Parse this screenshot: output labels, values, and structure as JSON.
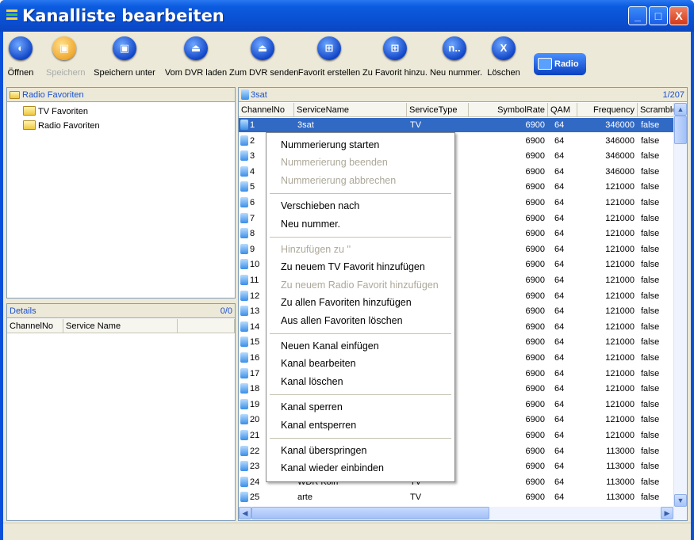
{
  "window": {
    "title": "Kanalliste bearbeiten",
    "controls": [
      "_",
      "□",
      "X"
    ]
  },
  "toolbar": {
    "buttons": [
      {
        "label": "Öffnen",
        "icon": "open-icon",
        "glyph": "◐",
        "enabled": true
      },
      {
        "label": "Speichern",
        "icon": "save-icon",
        "glyph": "▣",
        "enabled": false
      },
      {
        "label": "Speichern unter",
        "icon": "save-as-icon",
        "glyph": "▣",
        "enabled": true
      },
      {
        "label": "Vom DVR laden",
        "icon": "download-icon",
        "glyph": "⏏",
        "enabled": true
      },
      {
        "label": "Zum DVR senden",
        "icon": "upload-icon",
        "glyph": "⏏",
        "enabled": true
      },
      {
        "label": "Favorit erstellen",
        "icon": "create-favorite-icon",
        "glyph": "⊞",
        "enabled": true
      },
      {
        "label": "Zu Favorit hinzu.",
        "icon": "add-favorite-icon",
        "glyph": "⊞",
        "enabled": true
      },
      {
        "label": "Neu nummer.",
        "icon": "renumber-icon",
        "glyph": "n..",
        "enabled": true
      },
      {
        "label": "Löschen",
        "icon": "delete-icon",
        "glyph": "X",
        "enabled": true
      }
    ],
    "radio_label": "Radio"
  },
  "left_panel": {
    "header": "Radio Favoriten",
    "tree": [
      "TV Favoriten",
      "Radio Favoriten"
    ]
  },
  "details_panel": {
    "header": "Details",
    "count": "0/0",
    "columns": [
      "ChannelNo",
      "Service Name"
    ]
  },
  "channel_panel": {
    "header": "3sat",
    "count": "1/207",
    "columns": [
      "ChannelNo",
      "ServiceName",
      "ServiceType",
      "SymbolRate",
      "QAM",
      "Frequency",
      "Scramble"
    ],
    "rows": [
      {
        "no": "1",
        "name": "3sat",
        "type": "TV",
        "symbol": "6900",
        "qam": "64",
        "freq": "346000",
        "scr": "false"
      },
      {
        "no": "2",
        "name": "",
        "type": "",
        "symbol": "6900",
        "qam": "64",
        "freq": "346000",
        "scr": "false"
      },
      {
        "no": "3",
        "name": "",
        "type": "",
        "symbol": "6900",
        "qam": "64",
        "freq": "346000",
        "scr": "false"
      },
      {
        "no": "4",
        "name": "",
        "type": "",
        "symbol": "6900",
        "qam": "64",
        "freq": "346000",
        "scr": "false"
      },
      {
        "no": "5",
        "name": "",
        "type": "",
        "symbol": "6900",
        "qam": "64",
        "freq": "121000",
        "scr": "false"
      },
      {
        "no": "6",
        "name": "",
        "type": "",
        "symbol": "6900",
        "qam": "64",
        "freq": "121000",
        "scr": "false"
      },
      {
        "no": "7",
        "name": "",
        "type": "",
        "symbol": "6900",
        "qam": "64",
        "freq": "121000",
        "scr": "false"
      },
      {
        "no": "8",
        "name": "",
        "type": "",
        "symbol": "6900",
        "qam": "64",
        "freq": "121000",
        "scr": "false"
      },
      {
        "no": "9",
        "name": "",
        "type": "",
        "symbol": "6900",
        "qam": "64",
        "freq": "121000",
        "scr": "false"
      },
      {
        "no": "10",
        "name": "",
        "type": "",
        "symbol": "6900",
        "qam": "64",
        "freq": "121000",
        "scr": "false"
      },
      {
        "no": "11",
        "name": "",
        "type": "",
        "symbol": "6900",
        "qam": "64",
        "freq": "121000",
        "scr": "false"
      },
      {
        "no": "12",
        "name": "",
        "type": "",
        "symbol": "6900",
        "qam": "64",
        "freq": "121000",
        "scr": "false"
      },
      {
        "no": "13",
        "name": "",
        "type": "",
        "symbol": "6900",
        "qam": "64",
        "freq": "121000",
        "scr": "false"
      },
      {
        "no": "14",
        "name": "",
        "type": "",
        "symbol": "6900",
        "qam": "64",
        "freq": "121000",
        "scr": "false"
      },
      {
        "no": "15",
        "name": "",
        "type": "",
        "symbol": "6900",
        "qam": "64",
        "freq": "121000",
        "scr": "false"
      },
      {
        "no": "16",
        "name": "",
        "type": "",
        "symbol": "6900",
        "qam": "64",
        "freq": "121000",
        "scr": "false"
      },
      {
        "no": "17",
        "name": "",
        "type": "",
        "symbol": "6900",
        "qam": "64",
        "freq": "121000",
        "scr": "false"
      },
      {
        "no": "18",
        "name": "",
        "type": "",
        "symbol": "6900",
        "qam": "64",
        "freq": "121000",
        "scr": "false"
      },
      {
        "no": "19",
        "name": "",
        "type": "",
        "symbol": "6900",
        "qam": "64",
        "freq": "121000",
        "scr": "false"
      },
      {
        "no": "20",
        "name": "",
        "type": "",
        "symbol": "6900",
        "qam": "64",
        "freq": "121000",
        "scr": "false"
      },
      {
        "no": "21",
        "name": "",
        "type": "",
        "symbol": "6900",
        "qam": "64",
        "freq": "121000",
        "scr": "false"
      },
      {
        "no": "22",
        "name": "",
        "type": "",
        "symbol": "6900",
        "qam": "64",
        "freq": "113000",
        "scr": "false"
      },
      {
        "no": "23",
        "name": "",
        "type": "",
        "symbol": "6900",
        "qam": "64",
        "freq": "113000",
        "scr": "false"
      },
      {
        "no": "24",
        "name": "WDR Köln",
        "type": "TV",
        "symbol": "6900",
        "qam": "64",
        "freq": "113000",
        "scr": "false"
      },
      {
        "no": "25",
        "name": "arte",
        "type": "TV",
        "symbol": "6900",
        "qam": "64",
        "freq": "113000",
        "scr": "false"
      }
    ]
  },
  "context_menu": {
    "items": [
      {
        "label": "Nummerierung starten",
        "enabled": true
      },
      {
        "label": "Nummerierung beenden",
        "enabled": false
      },
      {
        "label": "Nummerierung abbrechen",
        "enabled": false
      },
      {
        "sep": true
      },
      {
        "label": "Verschieben nach",
        "enabled": true
      },
      {
        "label": "Neu nummer.",
        "enabled": true
      },
      {
        "sep": true
      },
      {
        "label": "Hinzufügen zu ''",
        "enabled": false
      },
      {
        "label": "Zu neuem TV Favorit hinzufügen",
        "enabled": true
      },
      {
        "label": "Zu neuem Radio Favorit hinzufügen",
        "enabled": false
      },
      {
        "label": "Zu allen Favoriten hinzufügen",
        "enabled": true
      },
      {
        "label": "Aus allen Favoriten löschen",
        "enabled": true
      },
      {
        "sep": true
      },
      {
        "label": "Neuen Kanal einfügen",
        "enabled": true
      },
      {
        "label": "Kanal bearbeiten",
        "enabled": true
      },
      {
        "label": "Kanal löschen",
        "enabled": true
      },
      {
        "sep": true
      },
      {
        "label": "Kanal sperren",
        "enabled": true
      },
      {
        "label": "Kanal entsperren",
        "enabled": true
      },
      {
        "sep": true
      },
      {
        "label": "Kanal überspringen",
        "enabled": true
      },
      {
        "label": "Kanal wieder einbinden",
        "enabled": true
      }
    ]
  },
  "colors": {
    "titlebar": "#0a50d8",
    "selection": "#316ac5",
    "link_text": "#1a4fd0"
  }
}
